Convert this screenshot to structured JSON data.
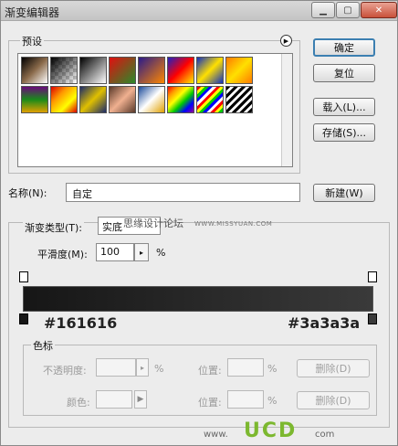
{
  "window": {
    "title": "渐变编辑器"
  },
  "buttons": {
    "ok": "确定",
    "reset": "复位",
    "load": "载入(L)...",
    "save": "存储(S)...",
    "new": "新建(W)"
  },
  "presets": {
    "legend": "预设"
  },
  "name": {
    "label": "名称(N):",
    "value": "自定"
  },
  "gradient": {
    "type_label": "渐变类型(T):",
    "type_value": "实底",
    "smoothness_label": "平滑度(M):",
    "smoothness_value": "100",
    "smoothness_unit": "%",
    "left_hex": "#161616",
    "right_hex": "#3a3a3a",
    "left_color": "#161616",
    "right_color": "#3a3a3a"
  },
  "stops": {
    "legend": "色标",
    "opacity_label": "不透明度:",
    "opacity_unit": "%",
    "position_label": "位置:",
    "position_unit": "%",
    "delete_label": "删除(D)",
    "color_label": "颜色:",
    "position2_label": "位置:",
    "position2_unit": "%",
    "delete2_label": "删除(D)"
  },
  "watermarks": {
    "forum": "思缘设计论坛",
    "url": "WWW.MISSYUAN.COM",
    "ucd_www": "www.",
    "ucd": "UCD",
    "ucd_com": "com"
  }
}
